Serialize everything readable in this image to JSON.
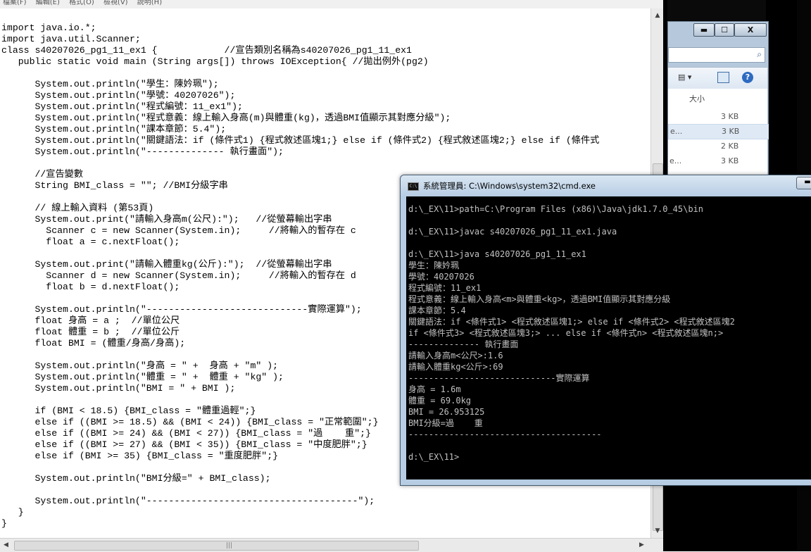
{
  "editor": {
    "menu": [
      "檔案(F)",
      "編輯(E)",
      "格式(O)",
      "檢視(V)",
      "說明(H)"
    ],
    "code": "import java.io.*;\nimport java.util.Scanner;\nclass s40207026_pg1_11_ex1 {            //宣告類別名稱為s40207026_pg1_11_ex1\n   public static void main (String args[]) throws IOException{ //拋出例外(pg2)\n\n      System.out.println(\"學生：陳妗珮\");\n      System.out.println(\"學號：40207026\");\n      System.out.println(\"程式編號：11_ex1\");\n      System.out.println(\"程式意義：線上輸入身高(m)與體重(kg)，透過BMI值顯示其對應分級\");\n      System.out.println(\"課本章節：5.4\");\n      System.out.println(\"關鍵語法：if (條件式1) {程式敘述區塊1;} else if (條件式2) {程式敘述區塊2;} else if (條件式\n      System.out.println(\"-------------- 執行畫面\");\n\n      //宣告變數\n      String BMI_class = \"\"; //BMI分級字串\n\n      // 線上輸入資料 (第53頁)\n      System.out.print(\"請輸入身高m(公尺):\");   //從螢幕輸出字串\n        Scanner c = new Scanner(System.in);     //將輸入的暫存在 c\n        float a = c.nextFloat();\n\n      System.out.print(\"請輸入體重kg(公斤):\");  //從螢幕輸出字串\n        Scanner d = new Scanner(System.in);     //將輸入的暫存在 d\n        float b = d.nextFloat();\n\n      System.out.println(\"-----------------------------實際運算\");\n      float 身高 = a ;  //單位公尺\n      float 體重 = b ;  //單位公斤\n      float BMI = (體重/身高/身高);\n\n      System.out.println(\"身高 = \" +  身高 + \"m\" );\n      System.out.println(\"體重 = \" +  體重 + \"kg\" );\n      System.out.println(\"BMI = \" + BMI );\n\n      if (BMI < 18.5) {BMI_class = \"體重過輕\";}\n      else if ((BMI >= 18.5) && (BMI < 24)) {BMI_class = \"正常範圍\";}\n      else if ((BMI >= 24) && (BMI < 27)) {BMI_class = \"過    重\";}\n      else if ((BMI >= 27) && (BMI < 35)) {BMI_class = \"中度肥胖\";}\n      else if (BMI >= 35) {BMI_class = \"重度肥胖\";}\n\n      System.out.println(\"BMI分級=\" + BMI_class);\n\n      System.out.println(\"--------------------------------------\");\n   }\n}"
  },
  "explorer": {
    "min": "▬",
    "max": "☐",
    "close": "X",
    "view_glyph": "▤ ▾",
    "help": "?",
    "size_header": "大小",
    "files": [
      {
        "name": "",
        "size": "3 KB"
      },
      {
        "name": "e...",
        "size": "3 KB"
      },
      {
        "name": "",
        "size": "2 KB"
      },
      {
        "name": "e...",
        "size": "3 KB"
      }
    ]
  },
  "cmd": {
    "title": "系統管理員: C:\\Windows\\system32\\cmd.exe",
    "output": "d:\\_EX\\11>path=C:\\Program Files (x86)\\Java\\jdk1.7.0_45\\bin\n\nd:\\_EX\\11>javac s40207026_pg1_11_ex1.java\n\nd:\\_EX\\11>java s40207026_pg1_11_ex1\n學生：陳妗珮\n學號：40207026\n程式編號：11_ex1\n程式意義：線上輸入身高<m>與體重<kg>，透過BMI值顯示其對應分級\n課本章節：5.4\n關鍵語法：if <條件式1> <程式敘述區塊1;> else if <條件式2> <程式敘述區塊2\nif <條件式3> <程式敘述區塊3;> ... else if <條件式n> <程式敘述區塊n;>\n-------------- 執行畫面\n請輸入身高m<公尺>:1.6\n請輸入體重kg<公斤>:69\n-----------------------------實際運算\n身高 = 1.6m\n體重 = 69.0kg\nBMI = 26.953125\nBMI分級=過    重\n--------------------------------------\n\nd:\\_EX\\11>"
  }
}
